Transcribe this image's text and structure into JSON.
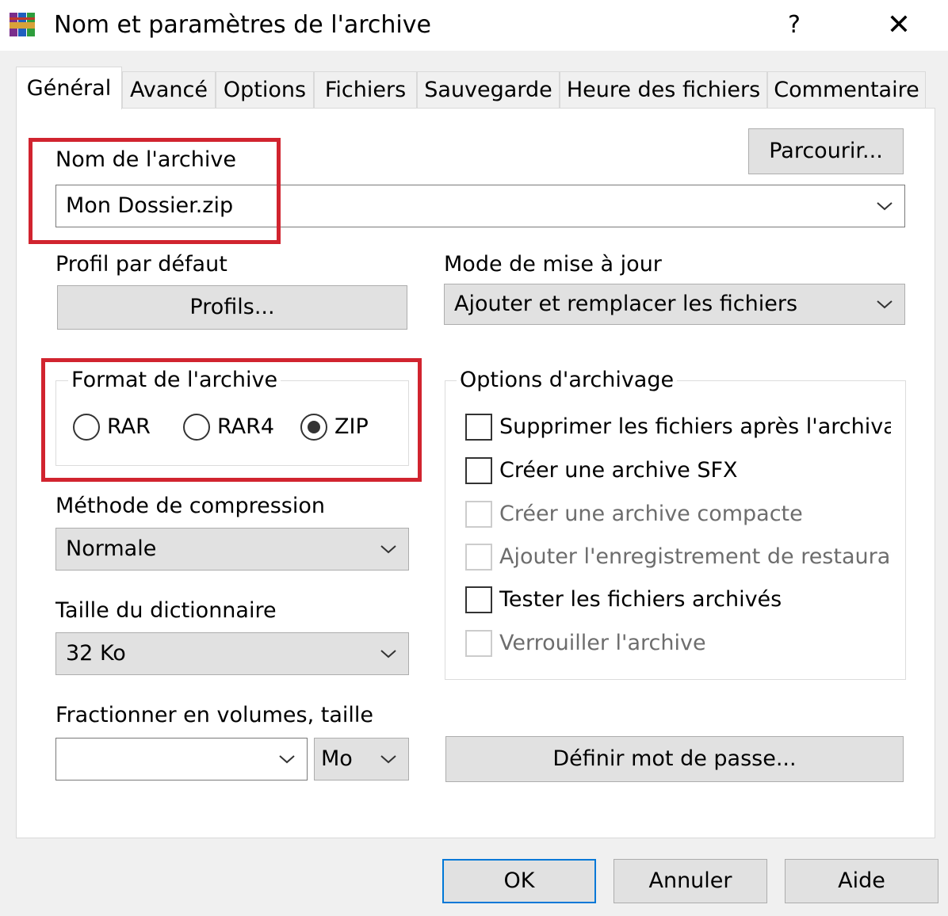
{
  "window": {
    "title": "Nom et paramètres de l'archive",
    "help_label": "?",
    "close_label": "✕"
  },
  "tabs": [
    {
      "label": "Général",
      "active": true
    },
    {
      "label": "Avancé"
    },
    {
      "label": "Options"
    },
    {
      "label": "Fichiers"
    },
    {
      "label": "Sauvegarde"
    },
    {
      "label": "Heure des fichiers"
    },
    {
      "label": "Commentaire"
    }
  ],
  "general": {
    "archive_name_label": "Nom de l'archive",
    "archive_name_value": "Mon Dossier.zip",
    "browse_button": "Parcourir...",
    "default_profile_label": "Profil par défaut",
    "profiles_button": "Profils...",
    "update_mode_label": "Mode de mise à jour",
    "update_mode_value": "Ajouter et remplacer les fichiers",
    "archive_format": {
      "title": "Format de l'archive",
      "options": [
        "RAR",
        "RAR4",
        "ZIP"
      ],
      "selected": "ZIP"
    },
    "compression_method_label": "Méthode de compression",
    "compression_method_value": "Normale",
    "dictionary_size_label": "Taille du dictionnaire",
    "dictionary_size_value": "32 Ko",
    "split_volumes_label": "Fractionner en volumes, taille",
    "split_volumes_value": "",
    "split_unit_value": "Mo",
    "archiving_options": {
      "title": "Options d'archivage",
      "items": [
        {
          "label": "Supprimer les fichiers après l'archivage",
          "checked": false,
          "enabled": true
        },
        {
          "label": "Créer une archive SFX",
          "checked": false,
          "enabled": true
        },
        {
          "label": "Créer une archive compacte",
          "checked": false,
          "enabled": false
        },
        {
          "label": "Ajouter l'enregistrement de restauration",
          "checked": false,
          "enabled": false
        },
        {
          "label": "Tester les fichiers archivés",
          "checked": false,
          "enabled": true
        },
        {
          "label": "Verrouiller l'archive",
          "checked": false,
          "enabled": false
        }
      ]
    },
    "set_password_button": "Définir mot de passe..."
  },
  "footer": {
    "ok_button": "OK",
    "cancel_button": "Annuler",
    "help_button": "Aide"
  },
  "colors": {
    "highlight": "#d1242f",
    "default_button_border": "#0078d7"
  },
  "icons": {
    "app": "winrar-books-icon",
    "chevron": "chevron-down-icon"
  }
}
